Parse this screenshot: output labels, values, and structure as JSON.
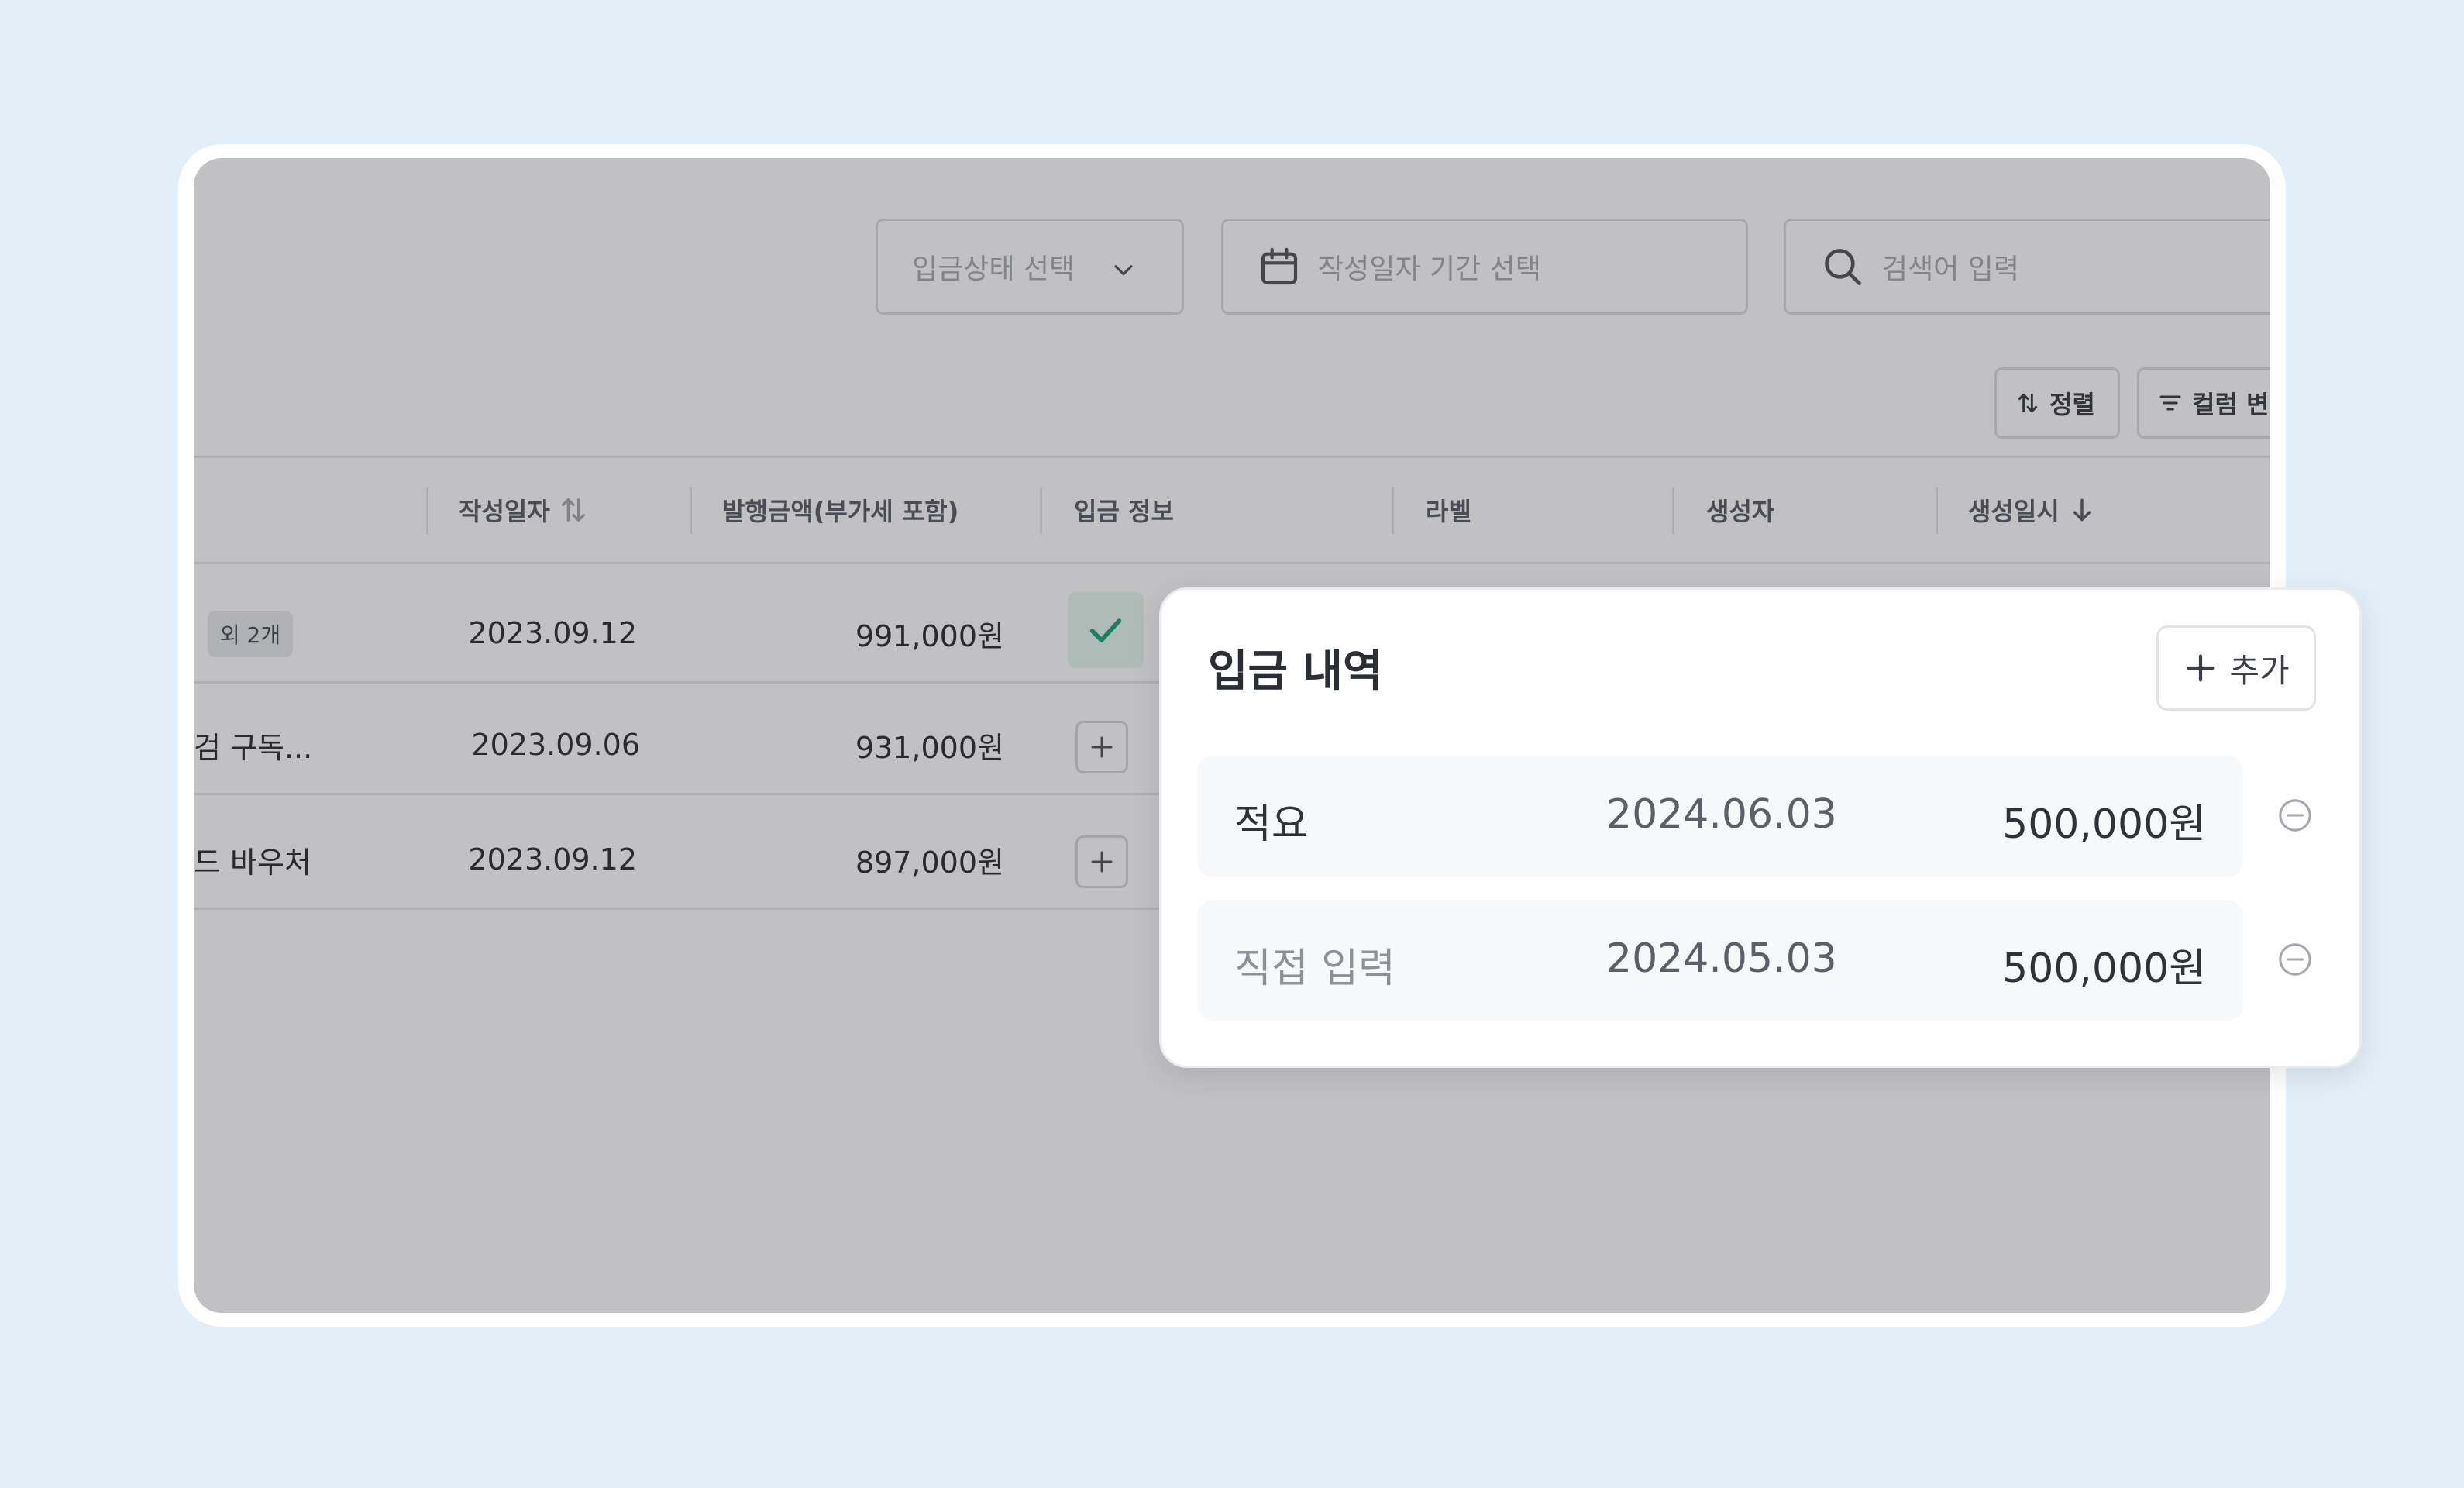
{
  "filters": {
    "status_placeholder": "입금상태 선택",
    "date_placeholder": "작성일자 기간 선택",
    "search_placeholder": "검색어 입력"
  },
  "toolbar": {
    "sort_label": "정렬",
    "columns_label": "컬럼 변경"
  },
  "table": {
    "headers": {
      "written_date": "작성일자",
      "issue_amount": "발행금액(부가세 포함)",
      "deposit_info": "입금 정보",
      "label": "라벨",
      "creator": "생성자",
      "created_at": "생성일시"
    },
    "rows": [
      {
        "item": "",
        "badge": "외 2개",
        "date": "2023.09.12",
        "amount": "991,000원",
        "deposit_state": "checked"
      },
      {
        "item": "검 구독...",
        "badge": "",
        "date": "2023.09.06",
        "amount": "931,000원",
        "deposit_state": "add"
      },
      {
        "item": "드 바우처",
        "badge": "",
        "date": "2023.09.12",
        "amount": "897,000원",
        "deposit_state": "add"
      }
    ]
  },
  "popover": {
    "title": "입금 내역",
    "add_label": "추가",
    "entries": [
      {
        "memo": "적요",
        "date": "2024.06.03",
        "amount": "500,000원"
      },
      {
        "memo": "직접 입력",
        "date": "2024.05.03",
        "amount": "500,000원"
      }
    ]
  },
  "colors": {
    "background": "#e2eef8",
    "check": "#1aa37a",
    "check_bg": "#e6f7ef"
  },
  "icons": [
    "chevron-down-icon",
    "calendar-icon",
    "search-icon",
    "sort-icon",
    "filter-icon",
    "sort-both-icon",
    "arrow-down-icon",
    "check-icon",
    "plus-icon",
    "minus-circle-icon"
  ]
}
